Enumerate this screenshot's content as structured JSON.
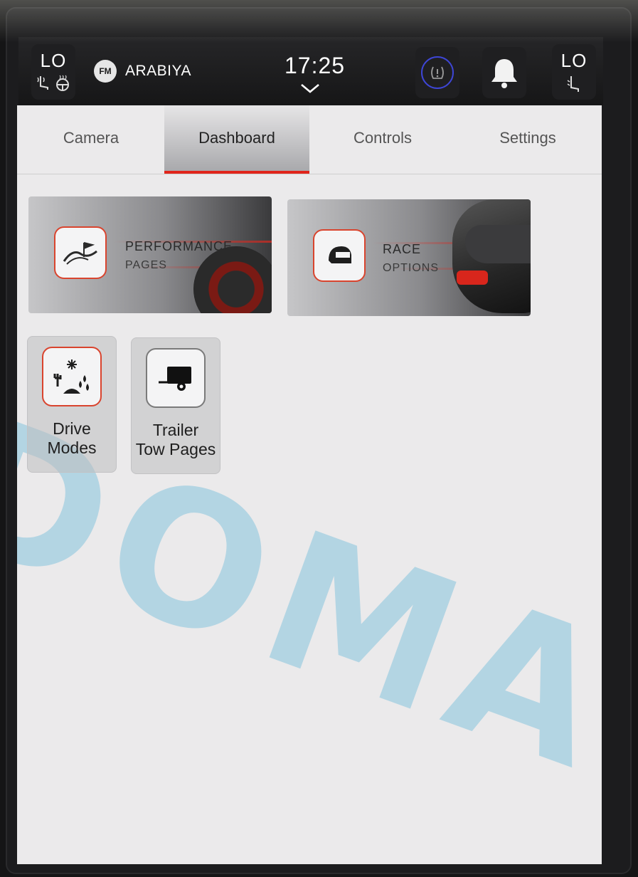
{
  "status_bar": {
    "left_seat": {
      "level": "LO",
      "icons": [
        "seat-heat-icon",
        "steering-wheel-heat-icon"
      ]
    },
    "radio": {
      "band": "FM",
      "station": "ARABIYA"
    },
    "clock": "17:25",
    "right_seat": {
      "level": "LO",
      "icon": "seat-vent-icon"
    },
    "icons": [
      "tire-pressure-icon",
      "bell-icon",
      "chevron-down-icon"
    ]
  },
  "tabs": [
    {
      "label": "Camera",
      "active": false
    },
    {
      "label": "Dashboard",
      "active": true
    },
    {
      "label": "Controls",
      "active": false
    },
    {
      "label": "Settings",
      "active": false
    }
  ],
  "tiles": {
    "performance": {
      "line1": "PERFORMANCE",
      "line2": "PAGES",
      "icon": "checkered-flag-road-icon"
    },
    "race": {
      "line1": "RACE",
      "line2": "OPTIONS",
      "icon": "helmet-icon"
    },
    "drive_modes": {
      "line1": "Drive",
      "line2": "Modes",
      "icon": "drive-modes-terrain-icon"
    },
    "trailer_tow": {
      "line1": "Trailer",
      "line2": "Tow Pages",
      "icon": "trailer-icon"
    }
  },
  "colors": {
    "accent": "#e0251b",
    "screen_bg": "#ebeaeb",
    "status_bg": "#1a1a1b",
    "tire_ring": "#3e46d6"
  }
}
